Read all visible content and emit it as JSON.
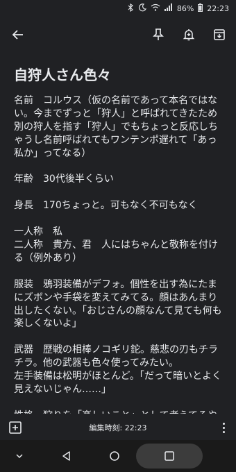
{
  "status_bar": {
    "battery": "86%",
    "time": "22:23",
    "icons": [
      "bluetooth-icon",
      "do-not-disturb-icon",
      "wifi-icon",
      "signal-icon",
      "battery-icon"
    ]
  },
  "toolbar": {
    "back_icon": "arrow-left-icon",
    "pin_icon": "pin-icon",
    "reminder_icon": "bell-plus-icon",
    "archive_icon": "archive-icon"
  },
  "note": {
    "title": "自狩人さん色々",
    "body": "名前　コルウス（仮の名前であって本名ではない。今までずっと「狩人」と呼ばれてきたため別の狩人を指す「狩人」でもちょっと反応しちゃうし名前呼ばれてもワンテンポ遅れて「あっ私か」ってなる）\n\n年齢　30代後半くらい\n\n身長　170ちょっと。可もなく不可もなく\n\n一人称　私\n二人称　貴方、君　人にはちゃんと敬称を付ける（例外あり）\n\n服装　鴉羽装備がデフォ。個性を出す為にたまにズボンや手袋を変えてみてる。顔はあんまり出したくない。「おじさんの顔なんて見ても何も楽しくないよ」\n\n武器　歴戦の相棒ノコギリ鉈。慈悲の刃もチラチラ。他の武器も色々使ってみたい。\n左手装備は松明がほとんど。「だって暗いとよく見えないじゃん……」\n\n性格　狩りを「楽しいこと」として考えてるや"
  },
  "bottom_bar": {
    "add_icon": "add-box-icon",
    "edited_time": "編集時刻: 22:23",
    "more_icon": "more-vert-icon"
  },
  "nav_bar": {
    "icons": [
      "chevron-down-icon",
      "back-triangle-icon",
      "recents-icon",
      "home-square-icon"
    ]
  }
}
